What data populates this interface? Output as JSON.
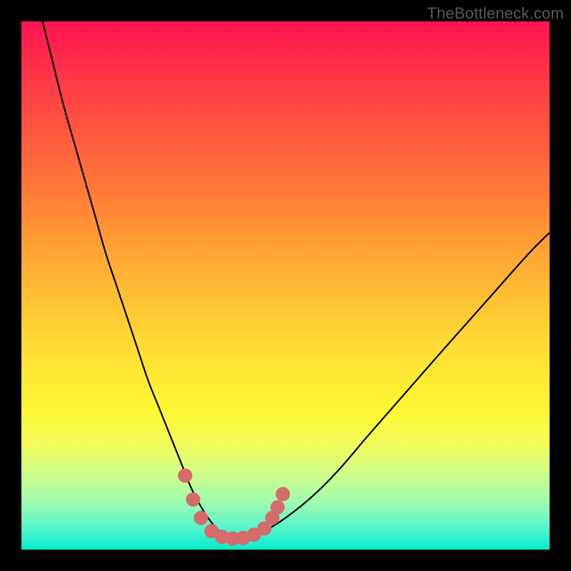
{
  "watermark": "TheBottleneck.com",
  "chart_data": {
    "type": "line",
    "title": "",
    "xlabel": "",
    "ylabel": "",
    "xlim": [
      0,
      100
    ],
    "ylim": [
      0,
      100
    ],
    "series": [
      {
        "name": "bottleneck-curve",
        "x": [
          4,
          6,
          8,
          10,
          12,
          14,
          16,
          18,
          20,
          22,
          24,
          26,
          28,
          30,
          32,
          33.5,
          35,
          36.5,
          38,
          39.5,
          41,
          43,
          46,
          50,
          55,
          60,
          66,
          73,
          80,
          88,
          96,
          100
        ],
        "y": [
          100,
          92,
          84,
          77,
          70,
          63,
          56,
          50,
          44,
          38,
          32,
          27,
          22,
          17,
          12,
          9,
          6.5,
          4.5,
          3,
          2.2,
          2,
          2.2,
          3.5,
          6,
          10,
          15,
          22,
          30,
          38,
          47,
          56,
          60
        ]
      }
    ],
    "markers": {
      "name": "optimal-range",
      "color": "#d76a6a",
      "points": [
        {
          "x": 31.0,
          "y": 14.0
        },
        {
          "x": 32.5,
          "y": 9.5
        },
        {
          "x": 34.0,
          "y": 6.0
        },
        {
          "x": 36.0,
          "y": 3.5
        },
        {
          "x": 38.0,
          "y": 2.4
        },
        {
          "x": 40.0,
          "y": 2.1
        },
        {
          "x": 42.0,
          "y": 2.2
        },
        {
          "x": 44.0,
          "y": 2.8
        },
        {
          "x": 46.0,
          "y": 4.0
        },
        {
          "x": 47.5,
          "y": 6.0
        },
        {
          "x": 48.5,
          "y": 8.0
        },
        {
          "x": 49.5,
          "y": 10.5
        }
      ]
    },
    "grid": false,
    "legend": false
  }
}
